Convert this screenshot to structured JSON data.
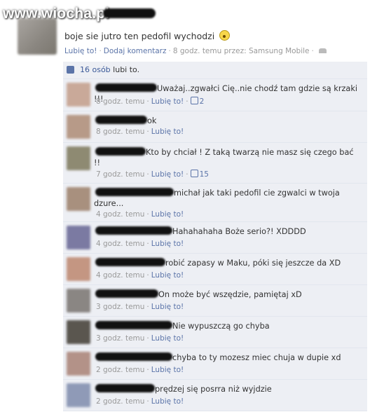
{
  "watermark": "www.wiocha.pl",
  "post": {
    "text": "boje sie jutro ten pedofil wychodzi",
    "like_label": "Lubię to!",
    "comment_label": "Dodaj komentarz",
    "timestamp": "8 godz. temu przez: Samsung Mobile",
    "sep": "·"
  },
  "likes": {
    "count_text": "16 osób",
    "suffix": "lubi to."
  },
  "comments": [
    {
      "text": "Uważaj..zgwałci Cię..nie chodź tam gdzie są krzaki !!!",
      "time": "8 godz. temu",
      "like_label": "Lubię to!",
      "likes": "2",
      "color": "#c9a999"
    },
    {
      "text": "ok",
      "time": "8 godz. temu",
      "like_label": "Lubię to!",
      "likes": "",
      "color": "#b79a88"
    },
    {
      "text": "Kto by chciał ! Z taką twarzą nie masz się czego bać !!",
      "time": "7 godz. temu",
      "like_label": "Lubię to!",
      "likes": "15",
      "color": "#8e8a72"
    },
    {
      "text": "michał jak taki pedofil cie zgwalci w twoja dzure...",
      "time": "4 godz. temu",
      "like_label": "Lubię to!",
      "likes": "",
      "color": "#a8907e"
    },
    {
      "text": "Hahahahaha Boże serio?! XDDDD",
      "time": "4 godz. temu",
      "like_label": "Lubię to!",
      "likes": "",
      "color": "#7b7aa2"
    },
    {
      "text": "robić zapasy w Maku, póki się jeszcze da XD",
      "time": "4 godz. temu",
      "like_label": "Lubię to!",
      "likes": "",
      "color": "#c49682"
    },
    {
      "text": "On może być wszędzie, pamiętaj xD",
      "time": "3 godz. temu",
      "like_label": "Lubię to!",
      "likes": "",
      "color": "#8a8683"
    },
    {
      "text": "Nie wypuszczą go chyba",
      "time": "3 godz. temu",
      "like_label": "Lubię to!",
      "likes": "",
      "color": "#5a564f"
    },
    {
      "text": "chyba to ty mozesz miec chuja w dupie xd",
      "time": "2 godz. temu",
      "like_label": "Lubię to!",
      "likes": "",
      "color": "#b39288"
    },
    {
      "text": "prędzej się posrra niż wyjdzie",
      "time": "2 godz. temu",
      "like_label": "Lubię to!",
      "likes": "",
      "color": "#8f9ab7"
    }
  ]
}
